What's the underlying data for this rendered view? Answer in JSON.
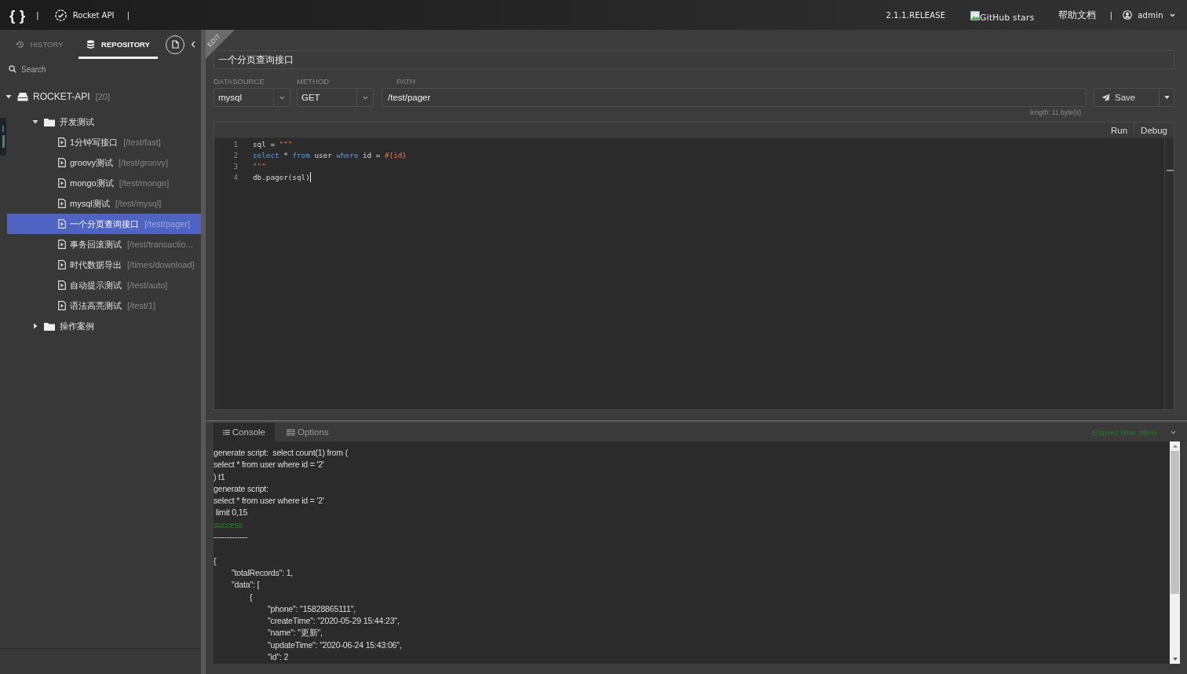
{
  "topbar": {
    "logo": "{ }",
    "separators": [
      "|",
      "|"
    ],
    "app_name": "Rocket API",
    "version": "2.1.1.RELEASE",
    "badge_text": "GitHub stars",
    "help_link": "帮助文档",
    "right_separator": "|",
    "user": "admin"
  },
  "sidebar": {
    "tabs": [
      {
        "label": "HISTORY",
        "selected": false
      },
      {
        "label": "REPOSITORY",
        "selected": true
      }
    ],
    "search": {
      "placeholder": "Search"
    },
    "tree": [
      {
        "kind": "root",
        "label": "ROCKET-API",
        "count": "[20]",
        "expanded": true,
        "selected": false,
        "children": [
          {
            "kind": "folder",
            "label": "开发测试",
            "expanded": true,
            "selected": false,
            "children": [
              {
                "kind": "api",
                "label": "1分钟写接口",
                "path": "[/test/fast]",
                "selected": false
              },
              {
                "kind": "api",
                "label": "groovy测试",
                "path": "[/test/groovy]",
                "selected": false
              },
              {
                "kind": "api",
                "label": "mongo测试",
                "path": "[/test/mongo]",
                "selected": false
              },
              {
                "kind": "api",
                "label": "mysql测试",
                "path": "[/test/mysql]",
                "selected": false
              },
              {
                "kind": "api",
                "label": "一个分页查询接口",
                "path": "[/test/pager]",
                "selected": true
              },
              {
                "kind": "api",
                "label": "事务回滚测试",
                "path": "[/test/transactio...",
                "selected": false
              },
              {
                "kind": "api",
                "label": "时代数据导出",
                "path": "[/times/download]",
                "selected": false
              },
              {
                "kind": "api",
                "label": "自动提示测试",
                "path": "[/test/auto]",
                "selected": false
              },
              {
                "kind": "api",
                "label": "语法高亮测试",
                "path": "[/test/1]",
                "selected": false
              }
            ]
          },
          {
            "kind": "folder",
            "label": "操作案例",
            "expanded": false,
            "selected": false
          }
        ]
      }
    ]
  },
  "editor": {
    "badge": "EDIT",
    "name": "一个分页查询接口",
    "fields": [
      {
        "kind": "select",
        "label": "DATASOURCE",
        "value": "mysql"
      },
      {
        "kind": "select",
        "label": "METHOD",
        "value": "GET"
      },
      {
        "kind": "text",
        "label": "PATH",
        "value": "/test/pager"
      }
    ],
    "save_button": "Save",
    "length_note": "length: 11 byte(s)",
    "actions": [
      "Run",
      "Debug"
    ],
    "code": [
      {
        "number": "1",
        "cursor": false,
        "tokens": [
          {
            "kind": "plain",
            "text": "sql = "
          },
          {
            "kind": "string",
            "text": "\"\"\""
          }
        ]
      },
      {
        "number": "2",
        "cursor": false,
        "tokens": [
          {
            "kind": "keyword",
            "text": "select"
          },
          {
            "kind": "plain",
            "text": " * "
          },
          {
            "kind": "keyword",
            "text": "from"
          },
          {
            "kind": "plain",
            "text": " user "
          },
          {
            "kind": "keyword",
            "text": "where"
          },
          {
            "kind": "plain",
            "text": " id = "
          },
          {
            "kind": "string",
            "text": "#{id}"
          }
        ]
      },
      {
        "number": "3",
        "cursor": false,
        "tokens": [
          {
            "kind": "string",
            "text": "\"\"\""
          }
        ]
      },
      {
        "number": "4",
        "cursor": true,
        "tokens": [
          {
            "kind": "plain",
            "text": "db.pager(sql)"
          }
        ]
      }
    ]
  },
  "console": {
    "tabs": [
      {
        "label": "Console",
        "selected": true
      },
      {
        "label": "Options",
        "selected": false
      }
    ],
    "elapsed": "Elapsed time: 98ms",
    "lines": [
      {
        "kind": "log",
        "text": "generate script:  select count(1) from ("
      },
      {
        "kind": "log",
        "text": "select * from user where id = '2'"
      },
      {
        "kind": "log",
        "text": ") t1"
      },
      {
        "kind": "log",
        "text": "generate script:"
      },
      {
        "kind": "log",
        "text": "select * from user where id = '2'"
      },
      {
        "kind": "log",
        "text": " limit 0,15"
      },
      {
        "kind": "success",
        "text": "success"
      },
      {
        "kind": "divider",
        "text": "-------------"
      },
      {
        "kind": "log",
        "text": "{"
      },
      {
        "kind": "log",
        "text": "\t\"totalRecords\": 1,"
      },
      {
        "kind": "log",
        "text": "\t\"data\": ["
      },
      {
        "kind": "log",
        "text": "\t\t{"
      },
      {
        "kind": "log",
        "text": "\t\t\t\"phone\": \"15828865111\","
      },
      {
        "kind": "log",
        "text": "\t\t\t\"createTime\": \"2020-05-29 15:44:23\","
      },
      {
        "kind": "log",
        "text": "\t\t\t\"name\": \"更新\","
      },
      {
        "kind": "log",
        "text": "\t\t\t\"updateTime\": \"2020-06-24 15:43:06\","
      },
      {
        "kind": "log",
        "text": "\t\t\t\"id\": 2"
      }
    ]
  }
}
